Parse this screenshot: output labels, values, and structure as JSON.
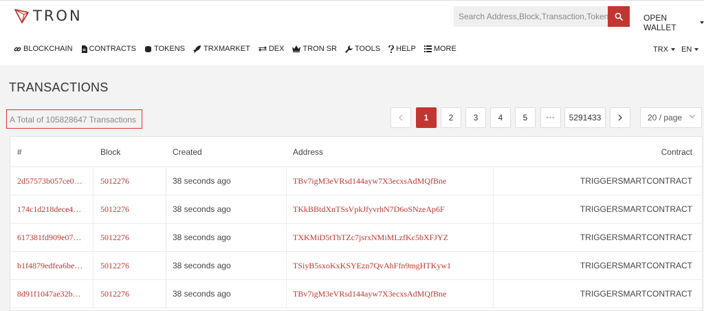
{
  "header": {
    "logo_text": "TRON",
    "search_placeholder": "Search Address,Block,Transaction,Token",
    "open_wallet": "OPEN WALLET"
  },
  "nav": {
    "items": [
      {
        "label": "BLOCKCHAIN",
        "icon": "link-icon"
      },
      {
        "label": "CONTRACTS",
        "icon": "document-icon"
      },
      {
        "label": "TOKENS",
        "icon": "coins-icon"
      },
      {
        "label": "TRXMARKET",
        "icon": "rocket-icon"
      },
      {
        "label": "DEX",
        "icon": "exchange-icon"
      },
      {
        "label": "TRON SR",
        "icon": "crown-icon"
      },
      {
        "label": "TOOLS",
        "icon": "wrench-icon"
      },
      {
        "label": "HELP",
        "icon": "question-icon"
      },
      {
        "label": "MORE",
        "icon": "list-icon"
      }
    ],
    "currency": "TRX",
    "language": "EN"
  },
  "page": {
    "title": "TRANSACTIONS",
    "total": "A Total of 105828647 Transactions"
  },
  "pagination": {
    "pages": [
      "1",
      "2",
      "3",
      "4",
      "5"
    ],
    "ellipsis": "•••",
    "last_page": "5291433",
    "per_page": "20 / page",
    "active": "1"
  },
  "table": {
    "headers": {
      "hash": "#",
      "block": "Block",
      "created": "Created",
      "address": "Address",
      "contract": "Contract"
    },
    "rows": [
      {
        "hash": "2d57573b057ce0…",
        "block": "5012276",
        "created": "38 seconds ago",
        "address": "TBv7igM3eVRsd144ayw7X3ecxsAdMQfBne",
        "contract": "TRIGGERSMARTCONTRACT"
      },
      {
        "hash": "174c1d218dece4…",
        "block": "5012276",
        "created": "38 seconds ago",
        "address": "TKkBBtdXnTSsVpkJfyvrhN7D6oSNzeAp6F",
        "contract": "TRIGGERSMARTCONTRACT"
      },
      {
        "hash": "617381fd909e07…",
        "block": "5012276",
        "created": "38 seconds ago",
        "address": "TXKMiD5tThTZc7jsrxNMiMLzfKc5bXFJYZ",
        "contract": "TRIGGERSMARTCONTRACT"
      },
      {
        "hash": "b1f4879edfea6be…",
        "block": "5012276",
        "created": "38 seconds ago",
        "address": "TSiyB5sxoKxKSYEzn7QvAhFfn9mgHTKyw1",
        "contract": "TRIGGERSMARTCONTRACT"
      },
      {
        "hash": "8d91f1047ae32b…",
        "block": "5012276",
        "created": "38 seconds ago",
        "address": "TBv7igM3eVRsd144ayw7X3ecxsAdMQfBne",
        "contract": "TRIGGERSMARTCONTRACT"
      }
    ]
  },
  "colors": {
    "accent": "#c23631",
    "header_bg": "#ffffff",
    "page_bg": "#f3f3f3"
  }
}
